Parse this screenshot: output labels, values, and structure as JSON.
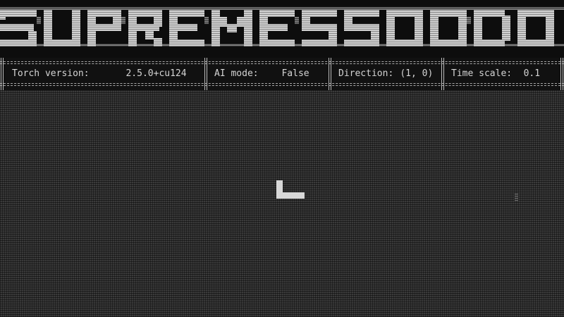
{
  "banner": {
    "text": "SUPREMESSOO"
  },
  "status": [
    {
      "label": "Torch version:",
      "value": "2.5.0+cu124"
    },
    {
      "label": "AI mode:",
      "value": "False"
    },
    {
      "label": "Direction:",
      "value": "(1, 0)"
    },
    {
      "label": "Time scale:",
      "value": "0.1"
    }
  ],
  "colors": {
    "background": "#0b0b0b",
    "playfield": "#3a3a3a",
    "snake": "#d8d8d8",
    "text": "#d4d4d4"
  },
  "game": {
    "snake_icon": "snake-body",
    "food_icon": "food-pellet"
  }
}
